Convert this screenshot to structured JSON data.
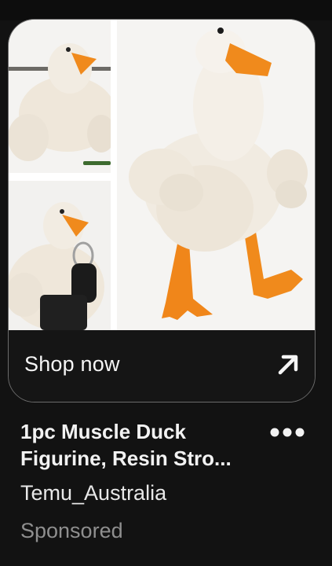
{
  "pin": {
    "image_alt": "Muscle duck figurine product photo collage",
    "shop_label": "Shop now",
    "title": "1pc Muscle Duck Figurine, Resin Stro...",
    "advertiser": "Temu_Australia",
    "sponsored_label": "Sponsored"
  },
  "icons": {
    "shop_arrow": "arrow-up-right-icon",
    "more": "more-options-icon"
  },
  "colors": {
    "background": "#121212",
    "duck_beak": "#f08a1c",
    "card_border": "#6b6b6b",
    "sponsored_text": "#8f8f8f"
  }
}
